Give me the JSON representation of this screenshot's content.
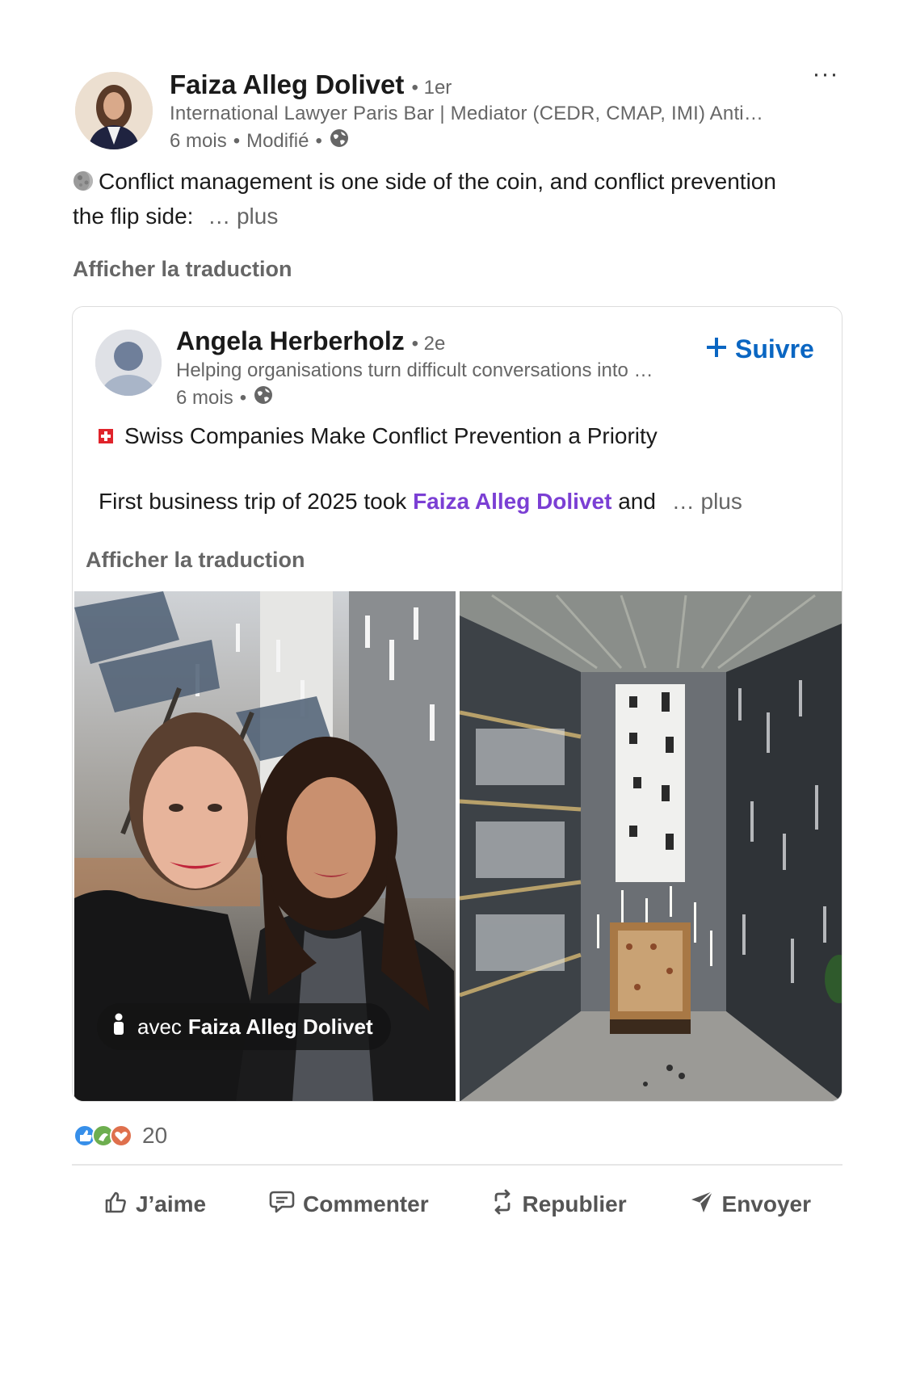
{
  "post": {
    "author_name": "Faiza Alleg Dolivet",
    "author_degree": "• 1er",
    "author_headline": "International Lawyer Paris Bar | Mediator (CEDR, CMAP, IMI) Anti…",
    "meta_time": "6 mois",
    "meta_sep1": "•",
    "meta_edited": "Modifié",
    "meta_sep2": "•",
    "more_label": "···",
    "text_line1": "Conflict management is one side of the coin, and conflict prevention",
    "text_line2": "the flip side:",
    "see_more": "… plus",
    "translate": "Afficher la traduction"
  },
  "shared": {
    "author_name": "Angela Herberholz",
    "author_degree": "• 2e",
    "author_headline": "Helping organisations turn difficult conversations into …",
    "meta_time": "6 mois",
    "meta_sep": "•",
    "follow_label": "Suivre",
    "title": "Swiss Companies Make Conflict Prevention a Priority",
    "body_prefix": "First business trip of 2025 took ",
    "mention": "Faiza Alleg Dolivet",
    "body_suffix": " and",
    "see_more": "… plus",
    "translate": "Afficher la traduction",
    "tag_prefix": "avec",
    "tag_name": "Faiza Alleg Dolivet"
  },
  "social": {
    "reaction_count": "20"
  },
  "actions": {
    "like": "J’aime",
    "comment": "Commenter",
    "repost": "Republier",
    "send": "Envoyer"
  },
  "colors": {
    "link_blue": "#0a66c2",
    "mention_purple": "#7b3fd4",
    "muted": "#666666"
  }
}
